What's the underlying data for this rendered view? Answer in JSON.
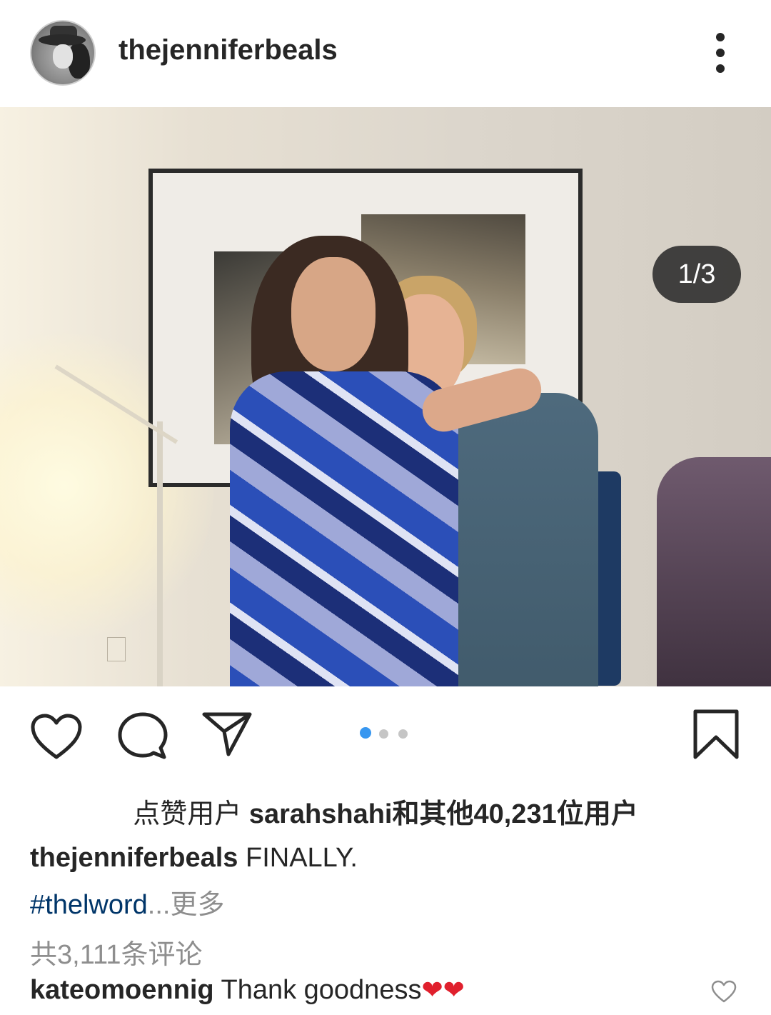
{
  "header": {
    "username": "thejenniferbeals"
  },
  "post": {
    "image_counter": "1/3",
    "carousel_total": 3,
    "carousel_active_index": 1
  },
  "likes": {
    "prefix": "点赞用户 ",
    "user": "sarahshahi",
    "suffix": "和其他40,231位用户"
  },
  "caption": {
    "username": "thejenniferbeals",
    "text": " FINALLY.",
    "hashtag": "#thelword",
    "more": "...更多"
  },
  "comments": {
    "count_text": "共3,111条评论",
    "first": {
      "username": "kateomoennig",
      "text": " Thank goodness",
      "hearts": "❤❤"
    }
  },
  "colors": {
    "accent_blue": "#3897f0",
    "hashtag": "#003569",
    "muted": "#8e8e8e",
    "heart_red": "#e0202d"
  }
}
